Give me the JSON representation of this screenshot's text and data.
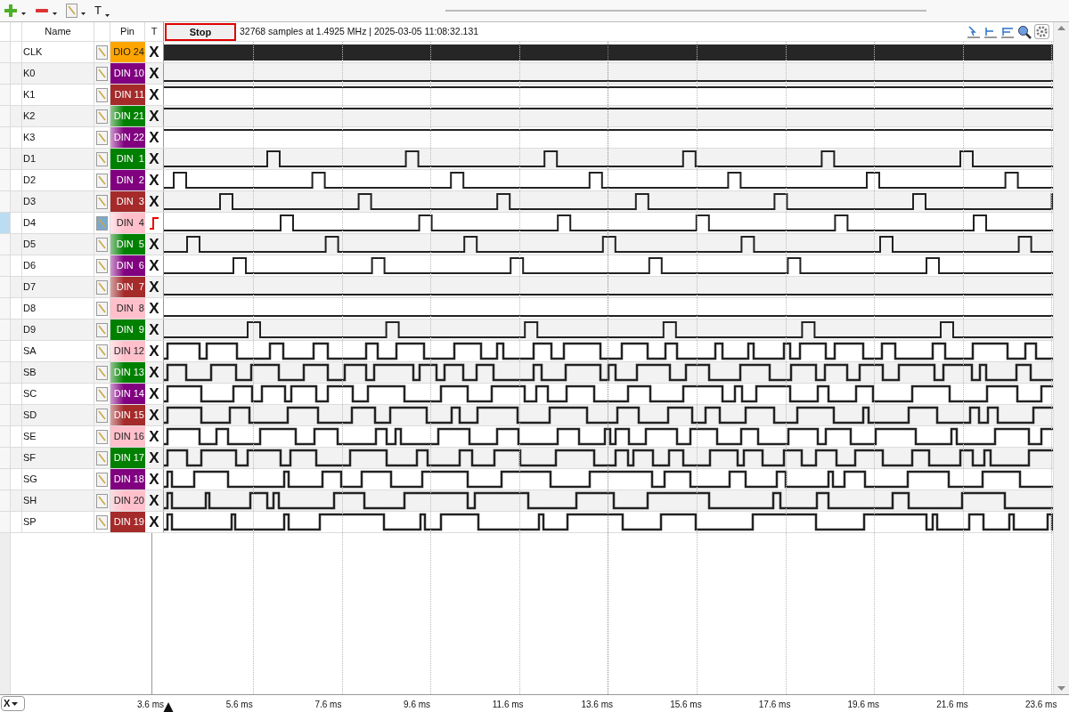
{
  "toolbar": {
    "buttons": [
      {
        "kind": "add"
      },
      {
        "kind": "remove"
      },
      {
        "kind": "edit"
      },
      {
        "kind": "text",
        "label": "T"
      }
    ]
  },
  "header": {
    "name_column": "Name",
    "pin_column": "Pin",
    "trigger_column": "T",
    "stop_button": "Stop",
    "info": "32768 samples at 1.4925 MHz | 2025-03-05 11:08:32.131"
  },
  "channels": [
    {
      "name": "CLK",
      "pin": "DIO 24",
      "color": "#ffa500",
      "faded": false,
      "trigger": {
        "kind": "x",
        "text": "X"
      },
      "kind": "clock",
      "selected": false
    },
    {
      "name": "K0",
      "pin": "DIN 10",
      "color": "#800080",
      "faded": false,
      "trigger": {
        "kind": "x",
        "text": "X"
      },
      "kind": "low",
      "selected": false
    },
    {
      "name": "K1",
      "pin": "DIN 11",
      "color": "#a52a2a",
      "faded": false,
      "trigger": {
        "kind": "x",
        "text": "X"
      },
      "kind": "high",
      "selected": false
    },
    {
      "name": "K2",
      "pin": "DIN 21",
      "color": "#008000",
      "faded": true,
      "trigger": {
        "kind": "x",
        "text": "X"
      },
      "kind": "high",
      "selected": false
    },
    {
      "name": "K3",
      "pin": "DIN 22",
      "color": "#800080",
      "faded": true,
      "trigger": {
        "kind": "x",
        "text": "X"
      },
      "kind": "high",
      "selected": false
    },
    {
      "name": "D1",
      "pin": "DIN  1",
      "color": "#008000",
      "faded": false,
      "trigger": {
        "kind": "x",
        "text": "X"
      },
      "kind": "pulse",
      "selected": false
    },
    {
      "name": "D2",
      "pin": "DIN  2",
      "color": "#800080",
      "faded": false,
      "trigger": {
        "kind": "x",
        "text": "X"
      },
      "kind": "pulse",
      "selected": false
    },
    {
      "name": "D3",
      "pin": "DIN  3",
      "color": "#a52a2a",
      "faded": false,
      "trigger": {
        "kind": "x",
        "text": "X"
      },
      "kind": "pulse",
      "selected": false
    },
    {
      "name": "D4",
      "pin": "DIN  4",
      "color": "#ffc0cb",
      "faded": true,
      "trigger": {
        "kind": "rising"
      },
      "kind": "pulse",
      "selected": true
    },
    {
      "name": "D5",
      "pin": "DIN  5",
      "color": "#008000",
      "faded": true,
      "trigger": {
        "kind": "x",
        "text": "X"
      },
      "kind": "pulse",
      "selected": false
    },
    {
      "name": "D6",
      "pin": "DIN  6",
      "color": "#800080",
      "faded": true,
      "trigger": {
        "kind": "x",
        "text": "X"
      },
      "kind": "pulse",
      "selected": false
    },
    {
      "name": "D7",
      "pin": "DIN  7",
      "color": "#a52a2a",
      "faded": true,
      "trigger": {
        "kind": "x",
        "text": "X"
      },
      "kind": "low",
      "selected": false
    },
    {
      "name": "D8",
      "pin": "DIN  8",
      "color": "#ffc0cb",
      "faded": false,
      "trigger": {
        "kind": "x",
        "text": "X"
      },
      "kind": "low",
      "selected": false
    },
    {
      "name": "D9",
      "pin": "DIN  9",
      "color": "#008000",
      "faded": false,
      "trigger": {
        "kind": "x",
        "text": "X"
      },
      "kind": "pulse",
      "selected": false
    },
    {
      "name": "SA",
      "pin": "DIN 12",
      "color": "#ffc0cb",
      "faded": true,
      "trigger": {
        "kind": "x",
        "text": "X"
      },
      "kind": "burst",
      "selected": false
    },
    {
      "name": "SB",
      "pin": "DIN 13",
      "color": "#008000",
      "faded": true,
      "trigger": {
        "kind": "x",
        "text": "X"
      },
      "kind": "burst",
      "selected": false
    },
    {
      "name": "SC",
      "pin": "DIN 14",
      "color": "#800080",
      "faded": true,
      "trigger": {
        "kind": "x",
        "text": "X"
      },
      "kind": "burst",
      "selected": false
    },
    {
      "name": "SD",
      "pin": "DIN 15",
      "color": "#a52a2a",
      "faded": true,
      "trigger": {
        "kind": "x",
        "text": "X"
      },
      "kind": "burst",
      "selected": false
    },
    {
      "name": "SE",
      "pin": "DIN 16",
      "color": "#ffc0cb",
      "faded": false,
      "trigger": {
        "kind": "x",
        "text": "X"
      },
      "kind": "burst",
      "selected": false
    },
    {
      "name": "SF",
      "pin": "DIN 17",
      "color": "#008000",
      "faded": false,
      "trigger": {
        "kind": "x",
        "text": "X"
      },
      "kind": "burst",
      "selected": false
    },
    {
      "name": "SG",
      "pin": "DIN 18",
      "color": "#800080",
      "faded": false,
      "trigger": {
        "kind": "x",
        "text": "X"
      },
      "kind": "strobe",
      "selected": false
    },
    {
      "name": "SH",
      "pin": "DIN 20",
      "color": "#ffc0cb",
      "faded": true,
      "trigger": {
        "kind": "x",
        "text": "X"
      },
      "kind": "strobe",
      "selected": false
    },
    {
      "name": "SP",
      "pin": "DIN 19",
      "color": "#a52a2a",
      "faded": false,
      "trigger": {
        "kind": "x",
        "text": "X"
      },
      "kind": "strobe",
      "selected": false
    }
  ],
  "time_axis": {
    "cursor_selector": "X",
    "ticks": [
      "3.6 ms",
      "5.6 ms",
      "7.6 ms",
      "9.6 ms",
      "11.6 ms",
      "13.6 ms",
      "15.6 ms",
      "17.6 ms",
      "19.6 ms",
      "21.6 ms",
      "23.6 ms"
    ]
  }
}
